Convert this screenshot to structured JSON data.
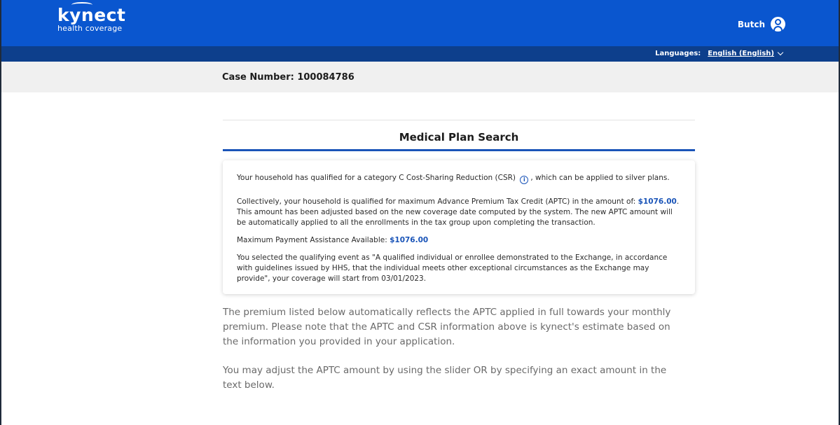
{
  "header": {
    "logo_main": "kynect",
    "logo_sub": "health coverage",
    "user_name": "Butch",
    "languages_label": "Languages:",
    "language_value": "English (English)"
  },
  "case": {
    "label": "Case Number: 100084786"
  },
  "main": {
    "section_title": "Medical Plan Search",
    "csr_text_before": "Your household has qualified for a category C Cost-Sharing Reduction (CSR)",
    "csr_text_after": ", which can be applied to silver plans.",
    "aptc_text_1": "Collectively, your household is qualified for maximum Advance Premium Tax Credit (APTC) in the amount of:",
    "aptc_amount": "$1076.00",
    "aptc_text_2": ". This amount has been adjusted based on the new coverage date computed by the system. The new APTC amount will be automatically applied to all the enrollments in the tax group upon completing the transaction.",
    "max_payment_label": "Maximum Payment Assistance Available:",
    "max_payment_amount": "$1076.00",
    "qualifying_event_text": "You selected the qualifying event as \"A qualified individual or enrollee demonstrated to the Exchange, in accordance with guidelines issued by HHS, that the individual meets other exceptional circumstances as the Exchange may provide\", your coverage will start from 03/01/2023.",
    "premium_note": "The premium listed below automatically reflects the APTC applied in full towards your monthly premium. Please note that the APTC and CSR information above is kynect's estimate based on the information you provided in your application.",
    "adjust_note": "You may adjust the APTC amount by using the slider OR by specifying an exact amount in the text below."
  },
  "colors": {
    "header_blue": "#0a56cf",
    "lang_bar_blue": "#0d3f8c",
    "accent_blue": "#1a54b8"
  }
}
